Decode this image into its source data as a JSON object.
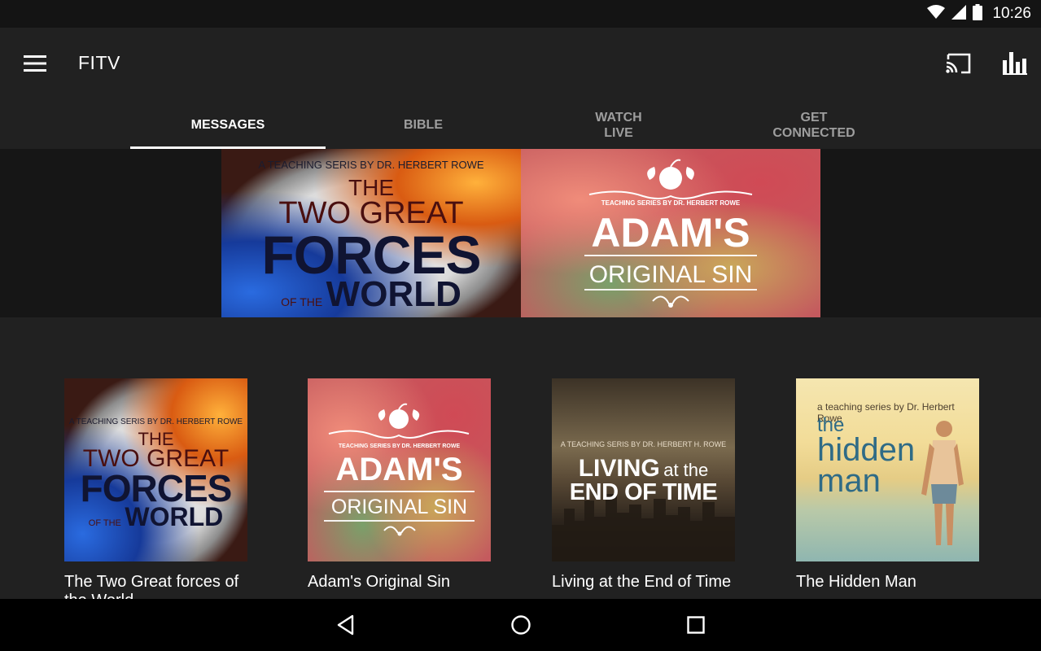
{
  "status_bar": {
    "time": "10:26",
    "icons": [
      "wifi-icon",
      "signal-icon",
      "battery-icon"
    ]
  },
  "app_bar": {
    "title": "FITV",
    "icons": [
      "menu-icon",
      "cast-icon",
      "bar-chart-icon"
    ]
  },
  "tabs": [
    {
      "label": "MESSAGES",
      "active": true
    },
    {
      "label": "BIBLE",
      "active": false
    },
    {
      "label": "WATCH\nLIVE",
      "active": false
    },
    {
      "label": "GET\nCONNECTED",
      "active": false
    }
  ],
  "hero": {
    "forces": {
      "subtitle": "A TEACHING SERIS BY DR. HERBERT ROWE",
      "line1": "THE",
      "line2": "TWO GREAT",
      "line3": "FORCES",
      "line4a": "OF THE",
      "line4b": "WORLD"
    },
    "adam": {
      "subtitle": "TEACHING SERIES BY DR. HERBERT ROWE",
      "line1": "ADAM'S",
      "line2": "ORIGINAL SIN"
    }
  },
  "cards": [
    {
      "title": "The Two Great forces of the World",
      "art": {
        "subtitle": "A TEACHING SERIS BY DR. HERBERT ROWE",
        "line1": "THE",
        "line2": "TWO GREAT",
        "line3": "FORCES",
        "line4a": "OF THE",
        "line4b": "WORLD"
      }
    },
    {
      "title": "Adam's Original Sin",
      "art": {
        "subtitle": "TEACHING SERIES BY DR. HERBERT ROWE",
        "line1": "ADAM'S",
        "line2": "ORIGINAL SIN"
      }
    },
    {
      "title": "Living at the End of Time",
      "art": {
        "subtitle": "A TEACHING SERIS BY DR. HERBERT H. ROWE",
        "line1a": "LIVING",
        "line1b": "at the",
        "line2": "END OF TIME"
      }
    },
    {
      "title": "The Hidden Man",
      "art": {
        "subtitle": "a teaching series by Dr. Herbert Rowe",
        "line1": "the",
        "line2": "hidden",
        "line3": "man"
      }
    }
  ],
  "nav_bar": {
    "icons": [
      "back-icon",
      "home-icon",
      "recents-icon"
    ]
  }
}
